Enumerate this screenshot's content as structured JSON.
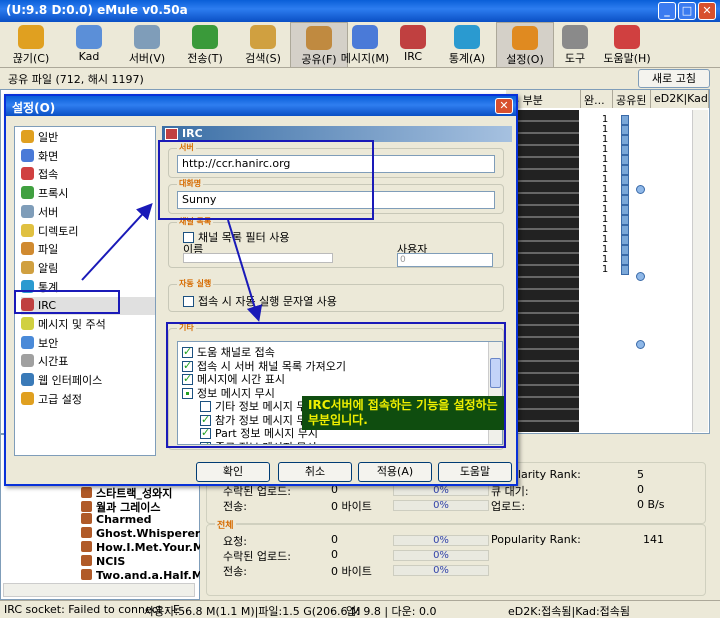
{
  "window": {
    "title": "(U:9.8 D:0.0) eMule v0.50a"
  },
  "toolbar": [
    {
      "label": "끊기(C)",
      "icon": "disconnect-icon",
      "color": "#e0a020"
    },
    {
      "label": "Kad",
      "icon": "kad-icon",
      "color": "#5b8fd8"
    },
    {
      "label": "서버(V)",
      "icon": "server-icon",
      "color": "#7f9db9"
    },
    {
      "label": "전송(T)",
      "icon": "transfer-icon",
      "color": "#3a9a3a"
    },
    {
      "label": "검색(S)",
      "icon": "search-icon",
      "color": "#d0a040"
    },
    {
      "label": "공유(F)",
      "icon": "shared-icon",
      "color": "#c08a40"
    },
    {
      "label": "메시지(M)",
      "icon": "message-icon",
      "color": "#4a7ad8"
    },
    {
      "label": "IRC",
      "icon": "irc-icon",
      "color": "#c04040"
    },
    {
      "label": "통계(A)",
      "icon": "statistics-icon",
      "color": "#2a9ad0"
    },
    {
      "label": "설정(O)",
      "icon": "settings-icon",
      "color": "#e08a20"
    },
    {
      "label": "도구",
      "icon": "tools-icon",
      "color": "#8a8a8a"
    },
    {
      "label": "도움말(H)",
      "icon": "help-icon",
      "color": "#d04040"
    }
  ],
  "shared": {
    "title": "공유 파일 (712, 해시 1197)",
    "refresh_label": "새로 고침"
  },
  "columns": [
    "유 부분",
    "완...",
    "공유된",
    "eD2K|Kad"
  ],
  "show_list": [
    "스타트랙_성와지",
    "월과 그레이스",
    "Charmed",
    "Ghost.Whisperer",
    "How.I.Met.Your.M",
    "NCIS",
    "Two.and.a.Half.M"
  ],
  "stats": {
    "session_label": "세션",
    "total_label": "전체",
    "session_rows": [
      {
        "label": "수락된 업로드:",
        "value": "0",
        "pct": "0%"
      },
      {
        "label": "전송:",
        "value": "0 바이트",
        "pct": "0%"
      }
    ],
    "session_right": [
      {
        "label": "Popularity Rank:",
        "value": "5"
      },
      {
        "label": "큐 대기:",
        "value": "0"
      },
      {
        "label": "업로드:",
        "value": "0 B/s"
      }
    ],
    "total_rows": [
      {
        "label": "요청:",
        "value": "0",
        "pct": "0%"
      },
      {
        "label": "수락된 업로드:",
        "value": "0",
        "pct": "0%"
      },
      {
        "label": "전송:",
        "value": "0 바이트",
        "pct": "0%"
      }
    ],
    "total_right": {
      "label": "Popularity Rank:",
      "value": "141"
    }
  },
  "statusbar": {
    "irc": "IRC socket: Failed to connect - E",
    "users": "사용자:56.8 M(1.1 M)|파일:1.5 G(206.6 M",
    "transfer": "업: 9.8 | 다운: 0.0",
    "network": "eD2K:접속됨|Kad:접속됨"
  },
  "dialog": {
    "title": "설정(O)",
    "nav": [
      {
        "label": "일반",
        "color": "#e0a020"
      },
      {
        "label": "화면",
        "color": "#4a7ad8"
      },
      {
        "label": "접속",
        "color": "#d04040"
      },
      {
        "label": "프록시",
        "color": "#40a040"
      },
      {
        "label": "서버",
        "color": "#7f9db9"
      },
      {
        "label": "디렉토리",
        "color": "#e0c040"
      },
      {
        "label": "파일",
        "color": "#d08a30"
      },
      {
        "label": "알림",
        "color": "#d0a040"
      },
      {
        "label": "통계",
        "color": "#2a9ad0"
      },
      {
        "label": "IRC",
        "color": "#c04040"
      },
      {
        "label": "메시지 및 주석",
        "color": "#d0d040"
      },
      {
        "label": "보안",
        "color": "#4a8ad8"
      },
      {
        "label": "시간표",
        "color": "#a0a0a0"
      },
      {
        "label": "웹 인터페이스",
        "color": "#3a7ab8"
      },
      {
        "label": "고급 설정",
        "color": "#e0a020"
      }
    ],
    "panel_title": "IRC",
    "server_group": "서버",
    "server_value": "http://ccr.hanirc.org",
    "nick_group": "대화명",
    "nick_value": "Sunny",
    "channel_group": "채널 목록",
    "channel_filter": "채널 목록 필터 사용",
    "name_label": "이름",
    "user_label": "사용자",
    "user_value": "0",
    "perform_group": "자동 실행",
    "perform_option": "접속 시 자동 실행 문자열 사용",
    "misc_group": "기타",
    "misc_options": [
      {
        "label": "도움 채널로 접속",
        "state": "on",
        "indent": 0
      },
      {
        "label": "접속 시 서버 채널 목록 가져오기",
        "state": "on",
        "indent": 0
      },
      {
        "label": "메시지에 시간 표시",
        "state": "on",
        "indent": 0
      },
      {
        "label": "정보 메시지 무시",
        "state": "part",
        "indent": 0
      },
      {
        "label": "기타 정보 메시지 무시",
        "state": "off",
        "indent": 1
      },
      {
        "label": "참가 정보 메시지 무시",
        "state": "on",
        "indent": 1
      },
      {
        "label": "Part 정보 메시지 무시",
        "state": "on",
        "indent": 1
      },
      {
        "label": "종료 정보 메시지 무시",
        "state": "on",
        "indent": 1
      }
    ],
    "buttons": {
      "ok": "확인",
      "cancel": "취소",
      "apply": "적용(A)",
      "help": "도움말"
    }
  },
  "annotation": {
    "callout": "IRC서버에 접속하는 기능을 설정하는 부분입니다."
  }
}
